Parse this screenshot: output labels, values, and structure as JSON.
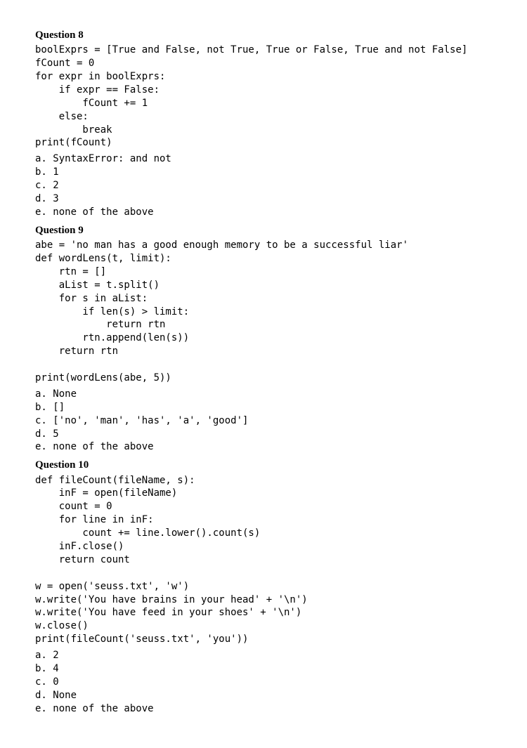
{
  "questions": [
    {
      "title": "Question 8",
      "code": "boolExprs = [True and False, not True, True or False, True and not False]\nfCount = 0\nfor expr in boolExprs:\n    if expr == False:\n        fCount += 1\n    else:\n        break\nprint(fCount)",
      "options": "a. SyntaxError: and not\nb. 1\nc. 2\nd. 3\ne. none of the above"
    },
    {
      "title": "Question 9",
      "code": "abe = 'no man has a good enough memory to be a successful liar'\ndef wordLens(t, limit):\n    rtn = []\n    aList = t.split()\n    for s in aList:\n        if len(s) > limit:\n            return rtn\n        rtn.append(len(s))\n    return rtn\n\nprint(wordLens(abe, 5))",
      "options": "a. None\nb. []\nc. ['no', 'man', 'has', 'a', 'good']\nd. 5\ne. none of the above"
    },
    {
      "title": "Question 10",
      "code": "def fileCount(fileName, s):\n    inF = open(fileName)\n    count = 0\n    for line in inF:\n        count += line.lower().count(s)\n    inF.close()\n    return count\n\nw = open('seuss.txt', 'w')\nw.write('You have brains in your head' + '\\n')\nw.write('You have feed in your shoes' + '\\n')\nw.close()\nprint(fileCount('seuss.txt', 'you'))",
      "options": "a. 2\nb. 4\nc. 0\nd. None\ne. none of the above"
    }
  ]
}
